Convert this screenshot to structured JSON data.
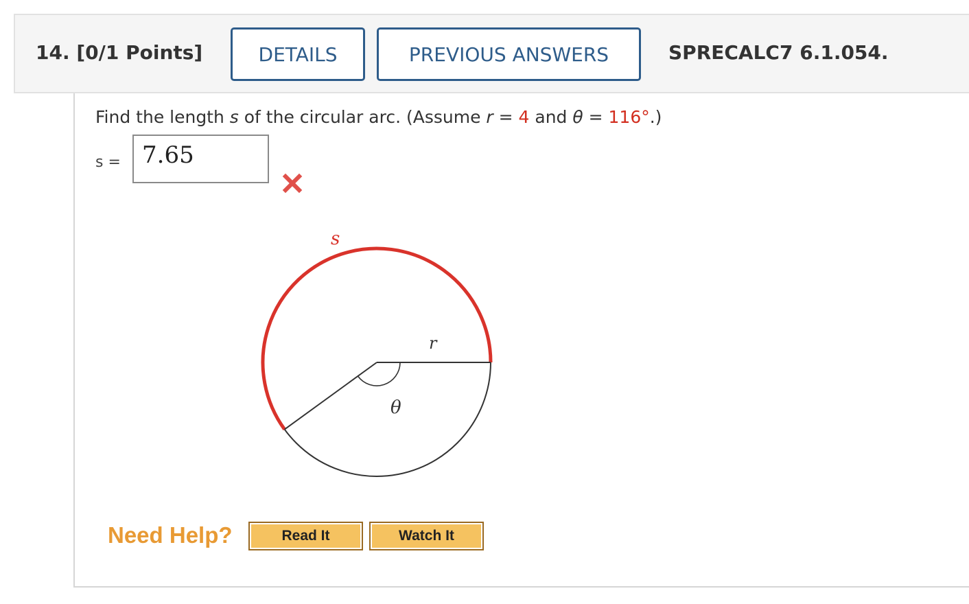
{
  "header": {
    "question_label": "14. [0/1 Points]",
    "details_label": "DETAILS",
    "previous_answers_label": "PREVIOUS ANSWERS",
    "reference_code": "SPRECALC7 6.1.054."
  },
  "question": {
    "prefix": "Find the length ",
    "var_s": "s",
    "mid": " of the circular arc. (Assume ",
    "var_r": "r",
    "eq1": " = ",
    "r_value": "4",
    "and": " and ",
    "var_theta": "θ",
    "eq2": " = ",
    "theta_value": "116°",
    "suffix": ".)"
  },
  "answer": {
    "label": "s =",
    "value": "7.65",
    "status_icon": "wrong-x-icon"
  },
  "diagram": {
    "arc_label": "s",
    "radius_label": "r",
    "angle_label": "θ",
    "angle_degrees": 144,
    "arc_color": "#d9332b"
  },
  "help": {
    "need_help_label": "Need Help?",
    "read_it_label": "Read It",
    "watch_it_label": "Watch It"
  },
  "colors": {
    "accent_blue": "#2e5c8a",
    "value_red": "#d22d1e",
    "help_orange": "#e89a34",
    "button_gold": "#f5c260"
  }
}
